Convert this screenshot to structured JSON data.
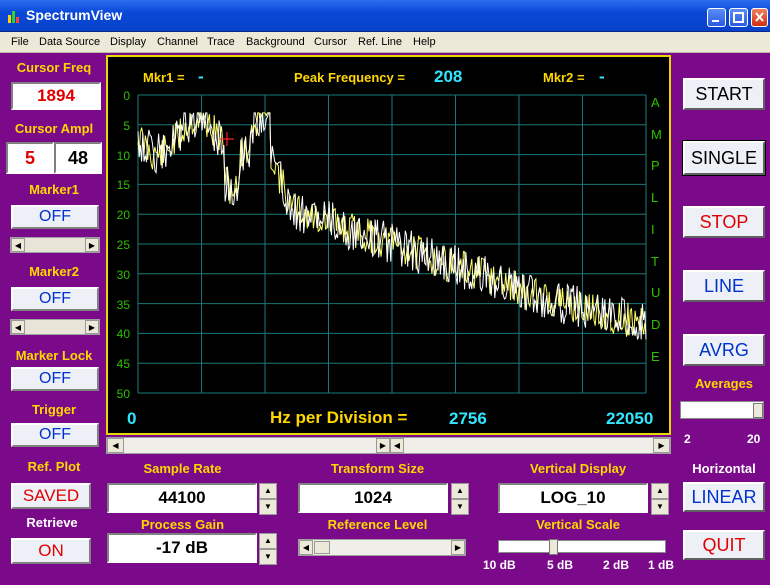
{
  "window": {
    "title": "SpectrumView"
  },
  "menu": [
    "File",
    "Data Source",
    "Display",
    "Channel",
    "Trace",
    "Background",
    "Cursor",
    "Ref. Line",
    "Help"
  ],
  "left": {
    "cursor_freq_label": "Cursor Freq",
    "cursor_freq_value": "1894",
    "cursor_ampl_label": "Cursor Ampl",
    "cursor_ampl_value1": "5",
    "cursor_ampl_value2": "48",
    "marker1_label": "Marker1",
    "marker1_value": "OFF",
    "marker2_label": "Marker2",
    "marker2_value": "OFF",
    "marker_lock_label": "Marker Lock",
    "marker_lock_value": "OFF",
    "trigger_label": "Trigger",
    "trigger_value": "OFF",
    "ref_plot_label": "Ref. Plot",
    "ref_plot_value": "SAVED",
    "retrieve_label": "Retrieve",
    "retrieve_value": "ON"
  },
  "plot": {
    "mkr1_label": "Mkr1 =",
    "mkr1_value": "-",
    "peak_label": "Peak Frequency =",
    "peak_value": "208",
    "mkr2_label": "Mkr2 =",
    "mkr2_value": "-",
    "y_ticks": [
      "0",
      "5",
      "10",
      "15",
      "20",
      "25",
      "30",
      "35",
      "40",
      "45",
      "50"
    ],
    "amplitude_letters": [
      "A",
      "M",
      "P",
      "L",
      "I",
      "T",
      "U",
      "D",
      "E"
    ],
    "x_start": "0",
    "hz_label": "Hz per Division =",
    "hz_value": "2756",
    "x_end": "22050"
  },
  "right": {
    "start": "START",
    "single": "SINGLE",
    "stop": "STOP",
    "line": "LINE",
    "avrg": "AVRG",
    "averages_label": "Averages",
    "averages_min": "2",
    "averages_max": "20",
    "averages_level": 1.0,
    "horizontal_label": "Horizontal",
    "horizontal_value": "LINEAR",
    "quit": "QUIT"
  },
  "bottom": {
    "sample_rate_label": "Sample Rate",
    "sample_rate_value": "44100",
    "transform_size_label": "Transform Size",
    "transform_size_value": "1024",
    "vertical_display_label": "Vertical Display",
    "vertical_display_value": "LOG_10",
    "process_gain_label": "Process Gain",
    "process_gain_value": "-17 dB",
    "reference_level_label": "Reference Level",
    "vertical_scale_label": "Vertical Scale",
    "vertical_scale_ticks": [
      "10 dB",
      "5 dB",
      "2 dB",
      "1 dB"
    ],
    "vertical_scale_selected": "5 dB"
  },
  "colors": {
    "background": "#7a0a8a",
    "plot_bg": "#000000",
    "grid": "#1a7a7a",
    "trace_white": "#ffffff",
    "trace_yellow": "#ffff66",
    "cursor": "#ff2020",
    "label_yellow": "#ffd700",
    "value_cyan": "#33e6ff"
  }
}
